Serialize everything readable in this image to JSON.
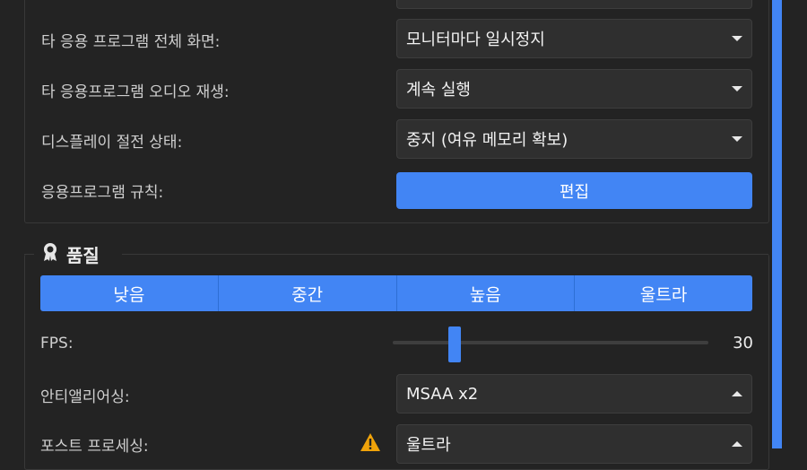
{
  "settings": {
    "rows": [
      {
        "label": "타 응용 프로그램 전체 화면:",
        "value": "모니터마다 일시정지"
      },
      {
        "label": "타 응용프로그램 오디오 재생:",
        "value": "계속 실행"
      },
      {
        "label": "디스플레이 절전 상태:",
        "value": "중지 (여유 메모리 확보)"
      },
      {
        "label": "응용프로그램 규칙:",
        "button": "편집"
      }
    ]
  },
  "quality": {
    "title": "품질",
    "icon": "medal-icon",
    "presets": [
      "낮음",
      "중간",
      "높음",
      "울트라"
    ],
    "fps": {
      "label": "FPS:",
      "value": "30",
      "level": 0.18
    },
    "antialiasing": {
      "label": "안티앨리어싱:",
      "value": "MSAA x2"
    },
    "postprocessing": {
      "label": "포스트 프로세싱:",
      "value": "울트라",
      "icon": "warning-icon"
    }
  },
  "colors": {
    "accent": "#4285f4",
    "background": "#232323",
    "warning": "#f0a30a"
  }
}
